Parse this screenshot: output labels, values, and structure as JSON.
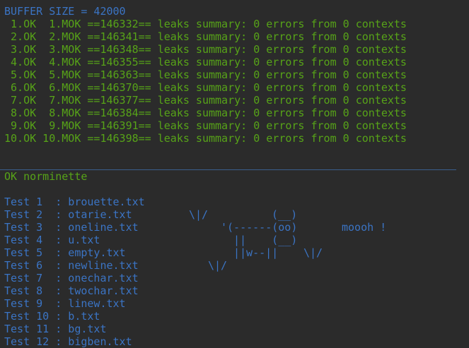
{
  "header": {
    "buffer_line": "BUFFER SIZE = 42000"
  },
  "results": [
    " 1.OK  1.MOK ==146332== leaks summary: 0 errors from 0 contexts",
    " 2.OK  2.MOK ==146341== leaks summary: 0 errors from 0 contexts",
    " 3.OK  3.MOK ==146348== leaks summary: 0 errors from 0 contexts",
    " 4.OK  4.MOK ==146355== leaks summary: 0 errors from 0 contexts",
    " 5.OK  5.MOK ==146363== leaks summary: 0 errors from 0 contexts",
    " 6.OK  6.MOK ==146370== leaks summary: 0 errors from 0 contexts",
    " 7.OK  7.MOK ==146377== leaks summary: 0 errors from 0 contexts",
    " 8.OK  8.MOK ==146384== leaks summary: 0 errors from 0 contexts",
    " 9.OK  9.MOK ==146391== leaks summary: 0 errors from 0 contexts",
    "10.OK 10.MOK ==146398== leaks summary: 0 errors from 0 contexts"
  ],
  "norminette": "OK norminette",
  "tests": [
    "Test 1  : brouette.txt",
    "Test 2  : otarie.txt",
    "Test 3  : oneline.txt",
    "Test 4  : u.txt",
    "Test 5  : empty.txt",
    "Test 6  : newline.txt",
    "Test 7  : onechar.txt",
    "Test 8  : twochar.txt",
    "Test 9  : linew.txt",
    "Test 10 : b.txt",
    "Test 11 : bg.txt",
    "Test 12 : bigben.txt"
  ],
  "cow_art": {
    "line2_a": "\\|/",
    "line2_b": "(__)",
    "line3_a": "'(------(oo)",
    "line3_b": "moooh !",
    "line4_a": "||    (__)",
    "line5_a": "||w--||",
    "line5_b": "\\|/",
    "line6_a": "\\|/"
  },
  "colors": {
    "background": "#2b2b2b",
    "blue_text": "#3b74c4",
    "green_text": "#57a318"
  }
}
